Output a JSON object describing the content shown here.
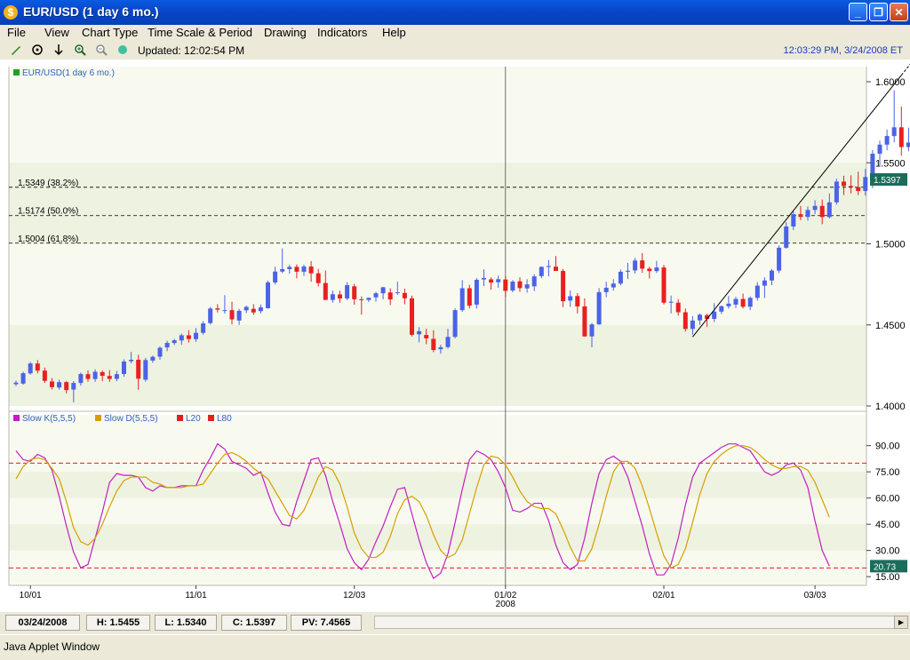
{
  "window": {
    "title": "EUR/USD (1 day  6 mo.)",
    "app_icon": "$",
    "buttons": {
      "minimize": "_",
      "maximize": "❐",
      "close": "✕"
    }
  },
  "menu": [
    "File",
    "View",
    "Chart Type",
    "Time Scale & Period",
    "Drawing",
    "Indicators",
    "Help"
  ],
  "toolbar": {
    "updated": "Updated: 12:02:54 PM",
    "clock": "12:03:29 PM, 3/24/2008 ET",
    "tools": [
      "pencil-icon",
      "crosshair-icon",
      "arrow-down-icon",
      "zoom-in-icon",
      "zoom-out-icon",
      "color-icon"
    ]
  },
  "colors": {
    "up": "#4b63e6",
    "down": "#e82020",
    "partial": "#f0a020",
    "slow_k": "#c020c0",
    "slow_d": "#d4a000",
    "level": "#e02020",
    "price_label_bg": "#1c6c5c"
  },
  "chart_data": [
    {
      "type": "candlestick",
      "legend": "EUR/USD(1 day  6 mo.)",
      "ylim": [
        1.4,
        1.6
      ],
      "yticks": [
        1.4,
        1.45,
        1.5,
        1.55,
        1.6
      ],
      "ytick_labels": [
        "1.4000",
        "1.4500",
        "1.5000",
        "1.5500",
        "1.6000"
      ],
      "last_price": 1.5397,
      "last_price_label": "1.5397",
      "xtick_labels": [
        {
          "label": "10/01",
          "index": 2
        },
        {
          "label": "11/01",
          "index": 25
        },
        {
          "label": "12/03",
          "index": 47
        },
        {
          "label": "01/02",
          "index": 68
        },
        {
          "label": "02/01",
          "index": 90
        },
        {
          "label": "03/03",
          "index": 111
        }
      ],
      "year_label": "2008",
      "fib_levels": [
        {
          "value": 1.5349,
          "label": "1.5349 (38.2%)"
        },
        {
          "value": 1.5174,
          "label": "1.5174 (50.0%)"
        },
        {
          "value": 1.5004,
          "label": "1.5004 (61.8%)"
        }
      ],
      "trendline": [
        {
          "index": 94,
          "value": 1.4426
        },
        {
          "index": 123,
          "value": 1.604
        }
      ],
      "cursor_index": 68,
      "ohlc": [
        [
          1.4134,
          1.4156,
          1.4122,
          1.4144
        ],
        [
          1.4138,
          1.4211,
          1.4131,
          1.4202
        ],
        [
          1.4201,
          1.4272,
          1.4193,
          1.4262
        ],
        [
          1.4262,
          1.4283,
          1.4201,
          1.4218
        ],
        [
          1.4218,
          1.4237,
          1.4142,
          1.4155
        ],
        [
          1.4151,
          1.4172,
          1.4102,
          1.4116
        ],
        [
          1.4114,
          1.4162,
          1.4101,
          1.4147
        ],
        [
          1.4147,
          1.4154,
          1.4078,
          1.4098
        ],
        [
          1.4101,
          1.4153,
          1.4022,
          1.4142
        ],
        [
          1.4142,
          1.4206,
          1.4126,
          1.4197
        ],
        [
          1.4196,
          1.4219,
          1.4149,
          1.4167
        ],
        [
          1.4166,
          1.4226,
          1.4149,
          1.4211
        ],
        [
          1.4209,
          1.4218,
          1.4153,
          1.4186
        ],
        [
          1.4185,
          1.4221,
          1.4149,
          1.4167
        ],
        [
          1.4167,
          1.4216,
          1.4152,
          1.4196
        ],
        [
          1.4197,
          1.4288,
          1.418,
          1.4274
        ],
        [
          1.4276,
          1.4333,
          1.4263,
          1.4285
        ],
        [
          1.4285,
          1.4316,
          1.41,
          1.4168
        ],
        [
          1.4162,
          1.4297,
          1.4151,
          1.4283
        ],
        [
          1.428,
          1.4311,
          1.4267,
          1.4303
        ],
        [
          1.4304,
          1.4367,
          1.4285,
          1.4359
        ],
        [
          1.4361,
          1.4402,
          1.4338,
          1.4389
        ],
        [
          1.4388,
          1.4413,
          1.4376,
          1.4405
        ],
        [
          1.4404,
          1.4446,
          1.4377,
          1.4436
        ],
        [
          1.4436,
          1.4467,
          1.4391,
          1.4413
        ],
        [
          1.4412,
          1.448,
          1.4395,
          1.4451
        ],
        [
          1.4451,
          1.4523,
          1.444,
          1.4509
        ],
        [
          1.4511,
          1.4611,
          1.4502,
          1.4601
        ],
        [
          1.4602,
          1.4628,
          1.4577,
          1.4594
        ],
        [
          1.4588,
          1.4684,
          1.457,
          1.4591
        ],
        [
          1.4591,
          1.4643,
          1.4503,
          1.4534
        ],
        [
          1.4527,
          1.4599,
          1.45,
          1.4587
        ],
        [
          1.459,
          1.4619,
          1.4573,
          1.4611
        ],
        [
          1.4599,
          1.4628,
          1.4562,
          1.4577
        ],
        [
          1.4585,
          1.4626,
          1.4571,
          1.4608
        ],
        [
          1.4603,
          1.4773,
          1.4601,
          1.4762
        ],
        [
          1.4762,
          1.4859,
          1.4749,
          1.4829
        ],
        [
          1.4829,
          1.4972,
          1.4819,
          1.4844
        ],
        [
          1.4844,
          1.4872,
          1.4816,
          1.4858
        ],
        [
          1.4858,
          1.4873,
          1.4788,
          1.4828
        ],
        [
          1.4828,
          1.4872,
          1.4802,
          1.486
        ],
        [
          1.486,
          1.4894,
          1.4766,
          1.4818
        ],
        [
          1.4818,
          1.4846,
          1.4737,
          1.4758
        ],
        [
          1.4758,
          1.4836,
          1.4719,
          1.4654
        ],
        [
          1.4654,
          1.4712,
          1.4637,
          1.4689
        ],
        [
          1.4688,
          1.4711,
          1.4637,
          1.4663
        ],
        [
          1.4663,
          1.4763,
          1.4652,
          1.4745
        ],
        [
          1.4738,
          1.4753,
          1.4625,
          1.4658
        ],
        [
          1.4658,
          1.4676,
          1.4563,
          1.4654
        ],
        [
          1.4654,
          1.4669,
          1.4642,
          1.4667
        ],
        [
          1.467,
          1.4704,
          1.4643,
          1.4695
        ],
        [
          1.4695,
          1.4735,
          1.4658,
          1.4732
        ],
        [
          1.47,
          1.4725,
          1.4622,
          1.4657
        ],
        [
          1.4696,
          1.4766,
          1.4686,
          1.4701
        ],
        [
          1.4697,
          1.4724,
          1.4627,
          1.4664
        ],
        [
          1.4664,
          1.468,
          1.4429,
          1.4439
        ],
        [
          1.4442,
          1.4486,
          1.4393,
          1.4461
        ],
        [
          1.4438,
          1.4476,
          1.4381,
          1.4417
        ],
        [
          1.4414,
          1.4467,
          1.4332,
          1.4345
        ],
        [
          1.435,
          1.4378,
          1.4322,
          1.4362
        ],
        [
          1.4363,
          1.4476,
          1.4353,
          1.4426
        ],
        [
          1.4426,
          1.4602,
          1.4418,
          1.4591
        ],
        [
          1.4591,
          1.4776,
          1.4581,
          1.4726
        ],
        [
          1.4726,
          1.4747,
          1.4601,
          1.4619
        ],
        [
          1.4625,
          1.4789,
          1.4601,
          1.4778
        ],
        [
          1.478,
          1.4843,
          1.4739,
          1.4789
        ],
        [
          1.4781,
          1.4793,
          1.4717,
          1.4761
        ],
        [
          1.4763,
          1.4804,
          1.4729,
          1.4782
        ],
        [
          1.478,
          1.4801,
          1.4671,
          1.471
        ],
        [
          1.4712,
          1.4777,
          1.4702,
          1.4767
        ],
        [
          1.4769,
          1.4793,
          1.4704,
          1.4727
        ],
        [
          1.4725,
          1.4782,
          1.4699,
          1.475
        ],
        [
          1.4738,
          1.4813,
          1.4709,
          1.4799
        ],
        [
          1.4801,
          1.486,
          1.4788,
          1.4858
        ],
        [
          1.4857,
          1.49,
          1.4799,
          1.4863
        ],
        [
          1.4859,
          1.4925,
          1.4846,
          1.4833
        ],
        [
          1.4833,
          1.4845,
          1.461,
          1.4646
        ],
        [
          1.465,
          1.4713,
          1.4611,
          1.4677
        ],
        [
          1.4678,
          1.4696,
          1.4571,
          1.4614
        ],
        [
          1.4614,
          1.4664,
          1.4427,
          1.4429
        ],
        [
          1.4429,
          1.4512,
          1.4362,
          1.4503
        ],
        [
          1.4503,
          1.4727,
          1.4501,
          1.4702
        ],
        [
          1.4702,
          1.4766,
          1.4671,
          1.4729
        ],
        [
          1.4731,
          1.4782,
          1.4711,
          1.4755
        ],
        [
          1.4755,
          1.4842,
          1.4744,
          1.4828
        ],
        [
          1.4828,
          1.4882,
          1.4783,
          1.4834
        ],
        [
          1.4836,
          1.4913,
          1.4817,
          1.4897
        ],
        [
          1.4898,
          1.4943,
          1.4821,
          1.4847
        ],
        [
          1.4847,
          1.4858,
          1.4786,
          1.4832
        ],
        [
          1.4832,
          1.4895,
          1.482,
          1.4854
        ],
        [
          1.4854,
          1.487,
          1.4626,
          1.4637
        ],
        [
          1.4637,
          1.4681,
          1.4571,
          1.4643
        ],
        [
          1.4637,
          1.4659,
          1.4557,
          1.4578
        ],
        [
          1.4578,
          1.4601,
          1.4459,
          1.4475
        ],
        [
          1.4475,
          1.4554,
          1.444,
          1.4527
        ],
        [
          1.4528,
          1.457,
          1.45,
          1.4563
        ],
        [
          1.456,
          1.4569,
          1.4488,
          1.4537
        ],
        [
          1.4537,
          1.4634,
          1.4518,
          1.4582
        ],
        [
          1.4582,
          1.4619,
          1.4567,
          1.4615
        ],
        [
          1.4615,
          1.4678,
          1.4601,
          1.4631
        ],
        [
          1.4625,
          1.4673,
          1.4604,
          1.466
        ],
        [
          1.466,
          1.4693,
          1.4601,
          1.4612
        ],
        [
          1.4612,
          1.4676,
          1.4591,
          1.4667
        ],
        [
          1.4667,
          1.4763,
          1.465,
          1.4742
        ],
        [
          1.4742,
          1.4793,
          1.4666,
          1.4774
        ],
        [
          1.4774,
          1.4844,
          1.4745,
          1.4835
        ],
        [
          1.4835,
          1.499,
          1.482,
          1.4976
        ],
        [
          1.4976,
          1.5134,
          1.497,
          1.5107
        ],
        [
          1.5107,
          1.5201,
          1.5085,
          1.5183
        ],
        [
          1.5183,
          1.5234,
          1.5146,
          1.5166
        ],
        [
          1.5166,
          1.5231,
          1.5143,
          1.5209
        ],
        [
          1.5209,
          1.5269,
          1.5183,
          1.5234
        ],
        [
          1.5234,
          1.5273,
          1.5121,
          1.5165
        ],
        [
          1.5165,
          1.5311,
          1.5157,
          1.5256
        ],
        [
          1.5256,
          1.5402,
          1.5242,
          1.5384
        ],
        [
          1.5384,
          1.542,
          1.5301,
          1.5357
        ],
        [
          1.5357,
          1.5423,
          1.5311,
          1.535
        ],
        [
          1.535,
          1.5445,
          1.5301,
          1.5326
        ],
        [
          1.5326,
          1.5462,
          1.5298,
          1.5412
        ],
        [
          1.5412,
          1.5578,
          1.5344,
          1.5556
        ],
        [
          1.5556,
          1.5637,
          1.5484,
          1.5612
        ],
        [
          1.5612,
          1.5705,
          1.5577,
          1.5665
        ],
        [
          1.5665,
          1.5948,
          1.5627,
          1.5719
        ],
        [
          1.5719,
          1.5847,
          1.5544,
          1.5597
        ],
        [
          1.5597,
          1.5717,
          1.5571,
          1.5625
        ],
        [
          1.5625,
          1.564,
          1.5354,
          1.5393
        ],
        [
          1.5393,
          1.5471,
          1.5364,
          1.5406
        ],
        [
          1.5406,
          1.5455,
          1.534,
          1.5397
        ]
      ]
    },
    {
      "type": "line",
      "legend": [
        {
          "name": "Slow K(5,5,5)",
          "color": "#c020c0"
        },
        {
          "name": "Slow D(5,5,5)",
          "color": "#d4a000"
        },
        {
          "name": "L20",
          "color": "#e02020"
        },
        {
          "name": "L80",
          "color": "#e02020"
        }
      ],
      "ylim": [
        10,
        100
      ],
      "yticks": [
        15,
        30,
        45,
        60,
        75,
        90
      ],
      "ytick_labels": [
        "15.00",
        "30.00",
        "45.00",
        "60.00",
        "75.00",
        "90.00"
      ],
      "levels": [
        20,
        80
      ],
      "last_value_label": "20.73",
      "series": [
        {
          "name": "Slow K(5,5,5)",
          "values": [
            87,
            82,
            81,
            85,
            83,
            76,
            61,
            44,
            29,
            20,
            22,
            37,
            52,
            69,
            74,
            73,
            73,
            72,
            66,
            64,
            67,
            66,
            66,
            67,
            67,
            67,
            76,
            83,
            91,
            88,
            81,
            79,
            77,
            73,
            75,
            63,
            52,
            45,
            44,
            58,
            70,
            82,
            83,
            73,
            58,
            45,
            31,
            23,
            19,
            25,
            35,
            44,
            55,
            65,
            66,
            51,
            36,
            23,
            14,
            17,
            28,
            46,
            65,
            82,
            87,
            85,
            82,
            75,
            66,
            53,
            52,
            54,
            57,
            57,
            47,
            33,
            23,
            19,
            22,
            37,
            57,
            74,
            82,
            84,
            81,
            72,
            58,
            44,
            28,
            16,
            16,
            22,
            37,
            56,
            72,
            80,
            83,
            86,
            89,
            91,
            91,
            89,
            87,
            81,
            75,
            73,
            75,
            79,
            80,
            76,
            66,
            47,
            30,
            21
          ]
        },
        {
          "name": "Slow D(5,5,5)",
          "values": [
            71,
            78,
            82,
            83,
            82,
            77,
            71,
            58,
            43,
            35,
            33,
            37,
            45,
            55,
            64,
            70,
            72,
            72,
            72,
            69,
            68,
            66,
            66,
            66,
            67,
            67,
            68,
            74,
            80,
            85,
            86,
            84,
            81,
            77,
            74,
            71,
            64,
            57,
            50,
            48,
            53,
            62,
            72,
            78,
            76,
            68,
            55,
            40,
            31,
            26,
            26,
            29,
            38,
            51,
            59,
            61,
            58,
            50,
            39,
            30,
            26,
            28,
            36,
            51,
            66,
            79,
            84,
            83,
            79,
            72,
            64,
            58,
            55,
            54,
            54,
            51,
            42,
            32,
            24,
            24,
            31,
            45,
            61,
            75,
            81,
            81,
            77,
            67,
            54,
            40,
            27,
            20,
            22,
            31,
            46,
            62,
            74,
            81,
            85,
            88,
            90,
            90,
            89,
            86,
            82,
            79,
            77,
            77,
            78,
            78,
            76,
            69,
            59,
            49
          ]
        }
      ]
    }
  ],
  "status": {
    "date": "03/24/2008",
    "high": "H: 1.5455",
    "low": "L: 1.5340",
    "close": "C: 1.5397",
    "pv": "PV: 7.4565"
  },
  "applet": {
    "label": "Java Applet Window"
  }
}
